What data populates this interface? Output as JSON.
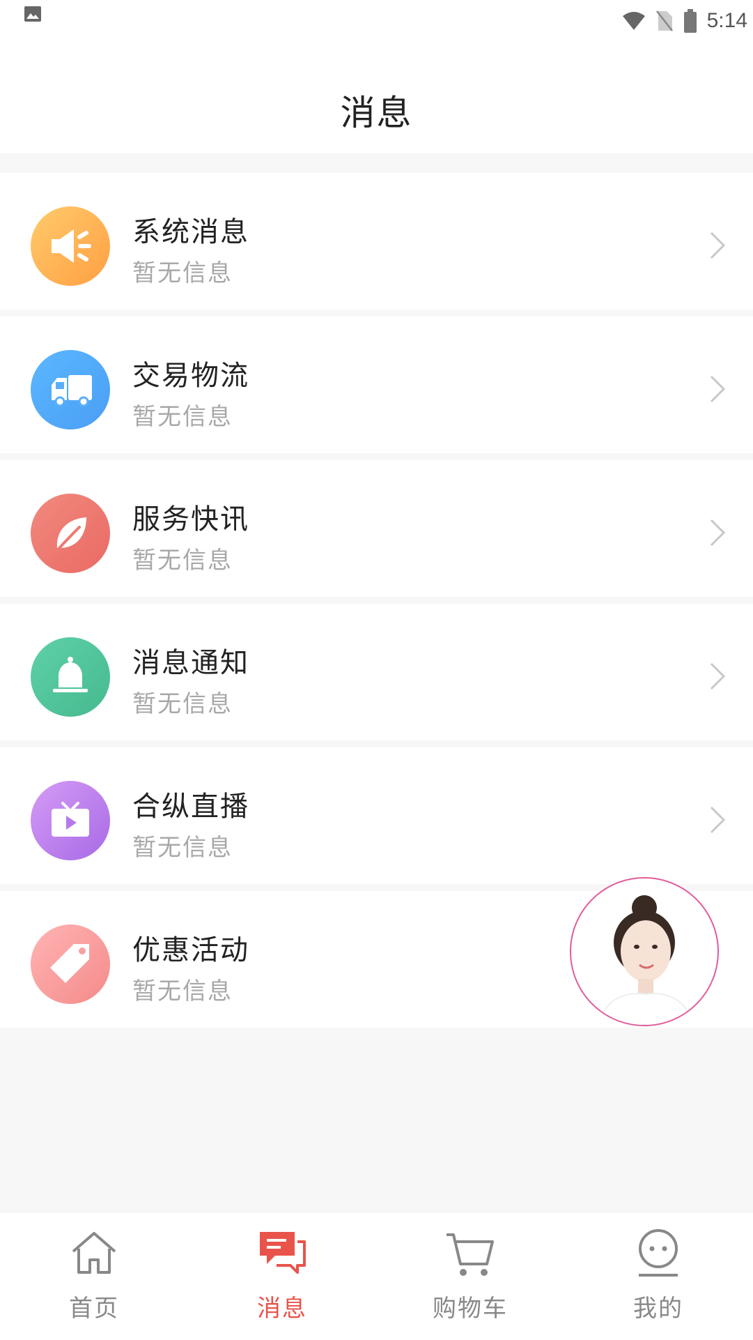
{
  "status_bar": {
    "time": "5:14"
  },
  "header": {
    "title": "消息"
  },
  "rows": [
    {
      "title": "系统消息",
      "subtitle": "暂无信息",
      "icon": "speaker-icon",
      "color_from": "#ffcb6b",
      "color_to": "#ff9f43"
    },
    {
      "title": "交易物流",
      "subtitle": "暂无信息",
      "icon": "truck-icon",
      "color_from": "#5bb7ff",
      "color_to": "#4a9ef5"
    },
    {
      "title": "服务快讯",
      "subtitle": "暂无信息",
      "icon": "leaf-icon",
      "color_from": "#f2897f",
      "color_to": "#e96a63"
    },
    {
      "title": "消息通知",
      "subtitle": "暂无信息",
      "icon": "bell-icon",
      "color_from": "#5fd1a8",
      "color_to": "#46b98f"
    },
    {
      "title": "合纵直播",
      "subtitle": "暂无信息",
      "icon": "tv-icon",
      "color_from": "#d59bf5",
      "color_to": "#a86ae6"
    },
    {
      "title": "优惠活动",
      "subtitle": "暂无信息",
      "icon": "tag-icon",
      "color_from": "#ffb4b4",
      "color_to": "#f58a8a"
    }
  ],
  "tabbar": {
    "tabs": [
      {
        "label": "首页",
        "icon": "home-icon"
      },
      {
        "label": "消息",
        "icon": "chat-icon",
        "active": true
      },
      {
        "label": "购物车",
        "icon": "cart-icon"
      },
      {
        "label": "我的",
        "icon": "profile-icon"
      }
    ],
    "accent_color": "#e8544b"
  }
}
